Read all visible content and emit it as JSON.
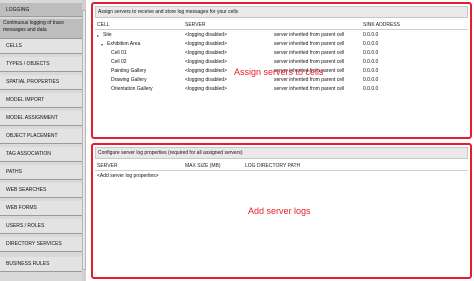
{
  "sidebar": {
    "active_label": "LOGGING",
    "active_description": "Continuous logging of trace messages and data",
    "items": [
      "CELLS",
      "TYPES / OBJECTS",
      "SPATIAL PROPERTIES",
      "MODEL IMPORT",
      "MODEL ASSIGNMENT",
      "OBJECT PLACEMENT",
      "TAG ASSOCIATION",
      "PATHS",
      "WEB SEARCHES",
      "WEB FORMS",
      "USERS / ROLES",
      "DIRECTORY SERVICES",
      "BUSINESS RULES"
    ]
  },
  "top_panel": {
    "header": "Assign servers to receive and store log messages for your cells",
    "columns": {
      "cell": "CELL",
      "server": "SERVER",
      "sink": "SINK ADDRESS"
    },
    "rows": [
      {
        "toggle": "▸",
        "cell": "Site",
        "server": "<logging disabled>",
        "inherited": "server inherited from parent cell",
        "sink": "0.0.0.0"
      },
      {
        "toggle": "▾",
        "cell": "Exhibition Area",
        "server": "<logging disabled>",
        "inherited": "server inherited from parent cell",
        "sink": "0.0.0.0"
      },
      {
        "toggle": "",
        "cell": "Cell 01",
        "server": "<logging disabled>",
        "inherited": "server inherited from parent cell",
        "sink": "0.0.0.0"
      },
      {
        "toggle": "",
        "cell": "Cell 02",
        "server": "<logging disabled>",
        "inherited": "server inherited from parent cell",
        "sink": "0.0.0.0"
      },
      {
        "toggle": "",
        "cell": "Painting Gallery",
        "server": "<logging disabled>",
        "inherited": "server inherited from parent cell",
        "sink": "0.0.0.0"
      },
      {
        "toggle": "",
        "cell": "Drawing Gallery",
        "server": "<logging disabled>",
        "inherited": "server inherited from parent cell",
        "sink": "0.0.0.0"
      },
      {
        "toggle": "",
        "cell": "Orientation Gallery",
        "server": "<logging disabled>",
        "inherited": "server inherited from parent cell",
        "sink": "0.0.0.0"
      }
    ],
    "overlay_label": "Assign servers to cells"
  },
  "bottom_panel": {
    "header": "Configure server log properties (required for all assigned servers)",
    "columns": {
      "server": "SERVER",
      "max_size": "MAX SIZE (MB)",
      "log_dir": "LOG DIRECTORY PATH"
    },
    "add_label": "<Add server log properties>",
    "overlay_label": "Add server logs"
  },
  "colors": {
    "accent": "#e61e2b",
    "sidebar_bg": "#d9d9d9",
    "active_bg": "#bdbdbd"
  }
}
